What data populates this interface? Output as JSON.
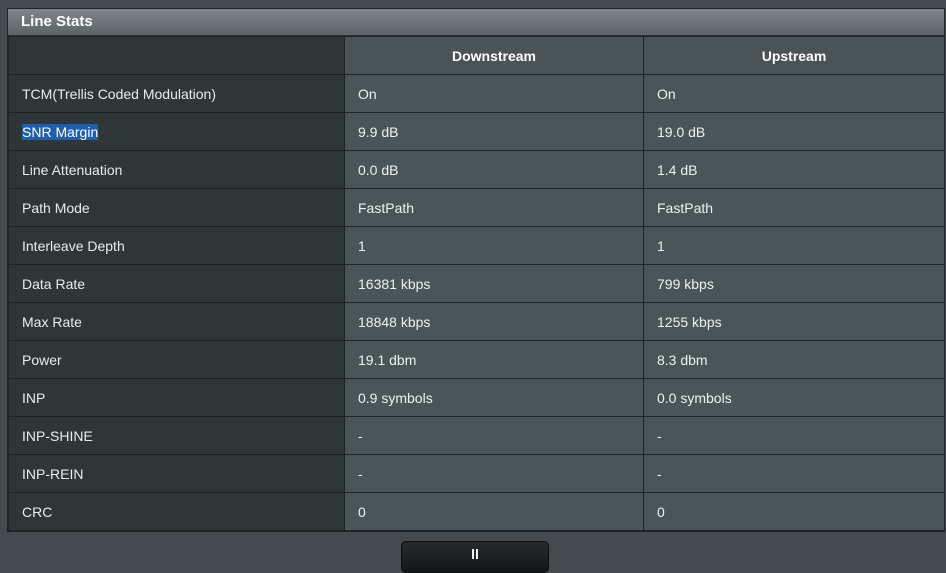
{
  "panel": {
    "title": "Line Stats"
  },
  "table": {
    "headers": [
      "",
      "Downstream",
      "Upstream"
    ],
    "rows": [
      {
        "label": "TCM(Trellis Coded Modulation)",
        "downstream": "On",
        "upstream": "On"
      },
      {
        "label": "SNR Margin",
        "downstream": "9.9 dB",
        "upstream": "19.0 dB"
      },
      {
        "label": "Line Attenuation",
        "downstream": "0.0 dB",
        "upstream": "1.4 dB"
      },
      {
        "label": "Path Mode",
        "downstream": "FastPath",
        "upstream": "FastPath"
      },
      {
        "label": "Interleave Depth",
        "downstream": "1",
        "upstream": "1"
      },
      {
        "label": "Data Rate",
        "downstream": "16381 kbps",
        "upstream": "799 kbps"
      },
      {
        "label": "Max Rate",
        "downstream": "18848 kbps",
        "upstream": "1255 kbps"
      },
      {
        "label": "Power",
        "downstream": "19.1 dbm",
        "upstream": "8.3 dbm"
      },
      {
        "label": "INP",
        "downstream": "0.9 symbols",
        "upstream": "0.0 symbols"
      },
      {
        "label": "INP-SHINE",
        "downstream": "-",
        "upstream": "-"
      },
      {
        "label": "INP-REIN",
        "downstream": "-",
        "upstream": "-"
      },
      {
        "label": "CRC",
        "downstream": "0",
        "upstream": "0"
      }
    ]
  },
  "footer": {
    "button_label": "ll"
  },
  "colors": {
    "background": "#444a4d",
    "label_cell": "#2f3638",
    "value_cell": "#4a5558",
    "selection": "#1f5fb0"
  }
}
